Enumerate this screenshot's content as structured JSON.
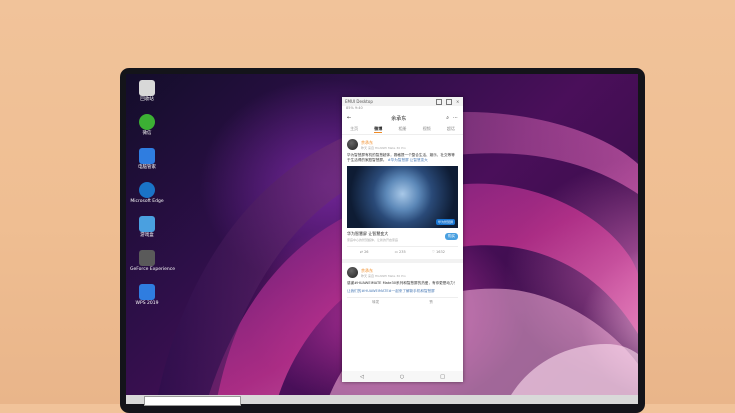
{
  "desktop": {
    "icons": [
      {
        "label": "回收站",
        "color": "#d8d8d8"
      },
      {
        "label": "微信",
        "color": "#3cb034"
      },
      {
        "label": "电脑管家",
        "color": "#2f7de0"
      },
      {
        "label": "Microsoft Edge",
        "color": "#1a73c7"
      },
      {
        "label": "游戏盒",
        "color": "#4aa0e0"
      },
      {
        "label": "GeForce Experience",
        "color": "#5a5a5a"
      },
      {
        "label": "WPS 2019",
        "color": "#2f7de0"
      }
    ]
  },
  "phone": {
    "window_title": "EMUI Desktop",
    "status": "85% 9:40",
    "nav_title": "余承东",
    "tabs": [
      "主页",
      "微博",
      "相册",
      "视频",
      "超话"
    ],
    "active_tab": 1,
    "post1": {
      "author": "余承东",
      "meta": "昨天 来自 HUAWEI Mate 30 Pro",
      "text": "华为智慧屏有机的智慧超体，赛格提一个整合生活、娱乐、社交等等于生活得的家庭智慧屏。",
      "link": "#华为智慧屏 让智慧变大",
      "image_tag": "华为智慧屏",
      "promo_title": "华为智慧屏 让智慧变大",
      "promo_sub": "家庭中心的智慧超体，让新的开启家庭",
      "promo_button": "购买",
      "actions": [
        "26",
        "235",
        "1632"
      ]
    },
    "post2": {
      "author": "余承东",
      "meta": "昨天 来自 HUAWEI Mate 30 Pro",
      "text": "感谢#HUAWEIMATE Mate30系列和智慧屏的热爱，有你更是动力！",
      "text2": "让我们的#HUAWEIMATE#一起来了解新手机和智慧屏",
      "actions": [
        "转发",
        "赞"
      ]
    },
    "bottom_nav": [
      "◁",
      "○",
      "□"
    ]
  },
  "colors": {
    "accent": "#f08a24",
    "link": "#4b7bb6"
  }
}
